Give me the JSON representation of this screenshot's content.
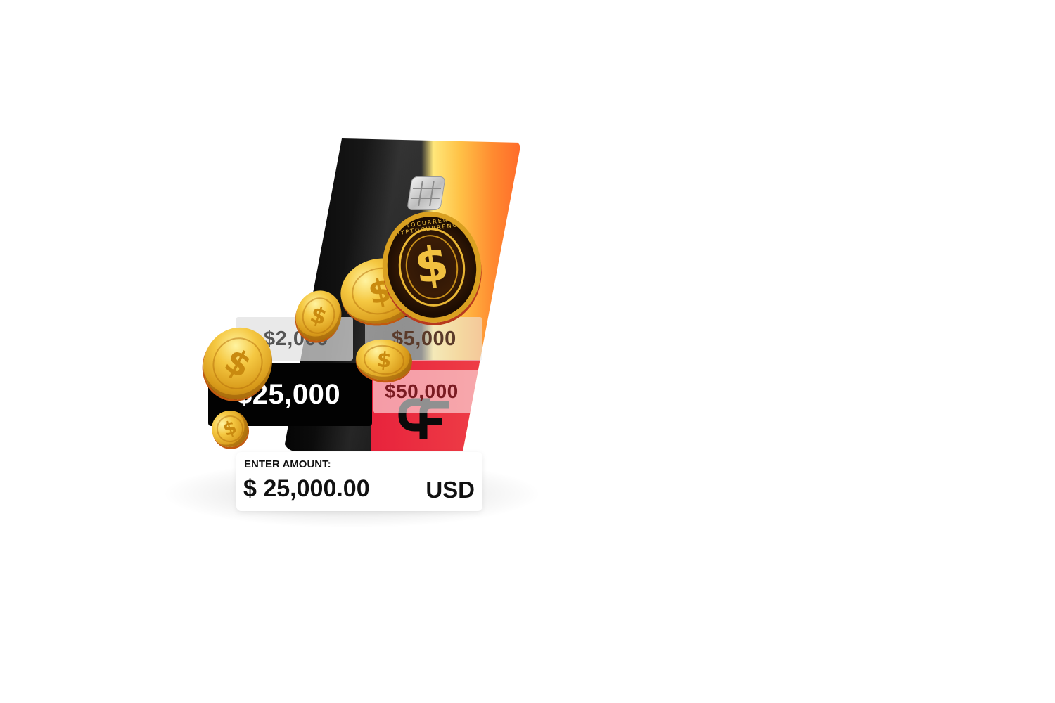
{
  "presets": {
    "p2000": "$2,000",
    "p5000": "$5,000",
    "p25000": "$25,000",
    "p50000": "$50,000"
  },
  "selected_preset": "$25,000",
  "coin_text": "CRYPTOCURRENCY · CRYPTOCURRENCY",
  "amount": {
    "label": "ENTER AMOUNT:",
    "value": "$ 25,000.00",
    "currency": "USD"
  },
  "colors": {
    "card_dark": "#050505",
    "card_gold": "#ffc247",
    "card_red": "#e8233c",
    "selected_bg": "#020202",
    "coin_gold": "#f5c842"
  }
}
